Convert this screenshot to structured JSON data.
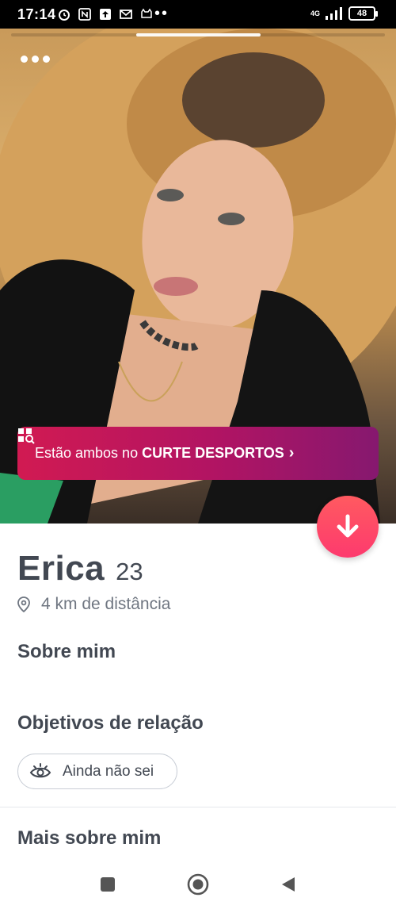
{
  "status_bar": {
    "time": "17:14",
    "network": "4G",
    "battery": "48",
    "extra": "••"
  },
  "photo": {
    "menu_icon": "more-dots-icon"
  },
  "shared_interest": {
    "text": "Estão ambos no",
    "highlight": "CURTE DESPORTOS",
    "chevron": "›",
    "icon": "interest-search-icon"
  },
  "profile": {
    "name": "Erica",
    "age": "23",
    "distance": "4 km de distância"
  },
  "sections": {
    "about": "Sobre mim",
    "goals": "Objetivos de relação",
    "goal_value": "Ainda não sei",
    "more": "Mais sobre mim"
  },
  "colors": {
    "accent": "#fd3a6e",
    "banner": "#b11463",
    "text": "#424852"
  }
}
